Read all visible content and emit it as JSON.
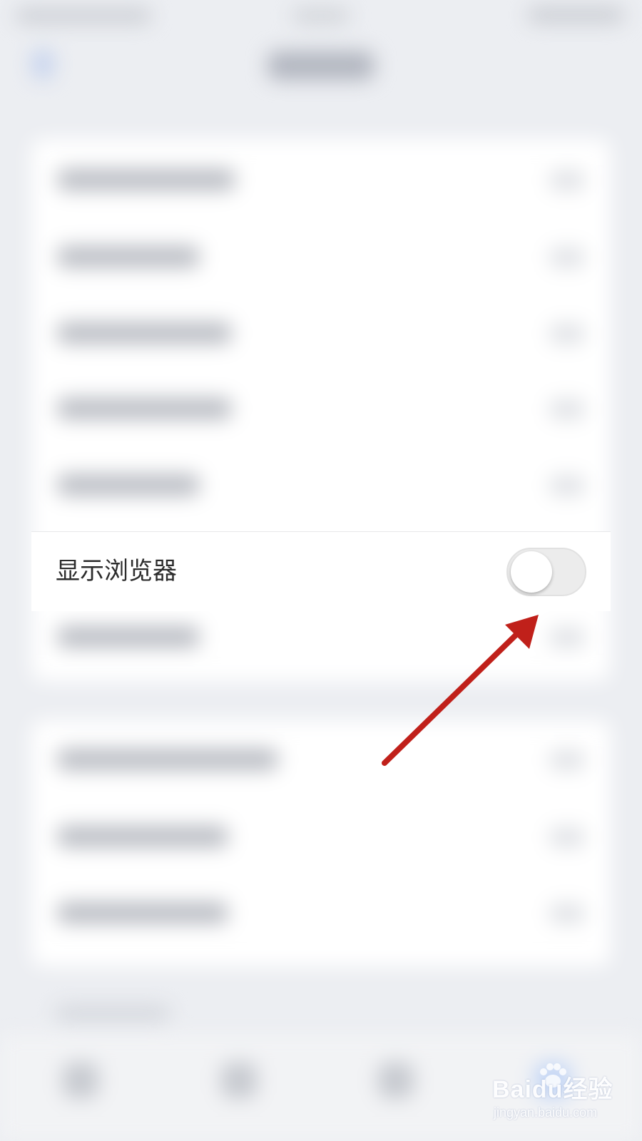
{
  "settings": {
    "show_browser_label": "显示浏览器",
    "show_browser_enabled": false
  },
  "watermark": {
    "logo_text": "Baidu经验",
    "url": "jingyan.baidu.com"
  },
  "colors": {
    "arrow": "#c0201a",
    "toggle_off_track": "#ececec",
    "background": "#eceef2"
  }
}
